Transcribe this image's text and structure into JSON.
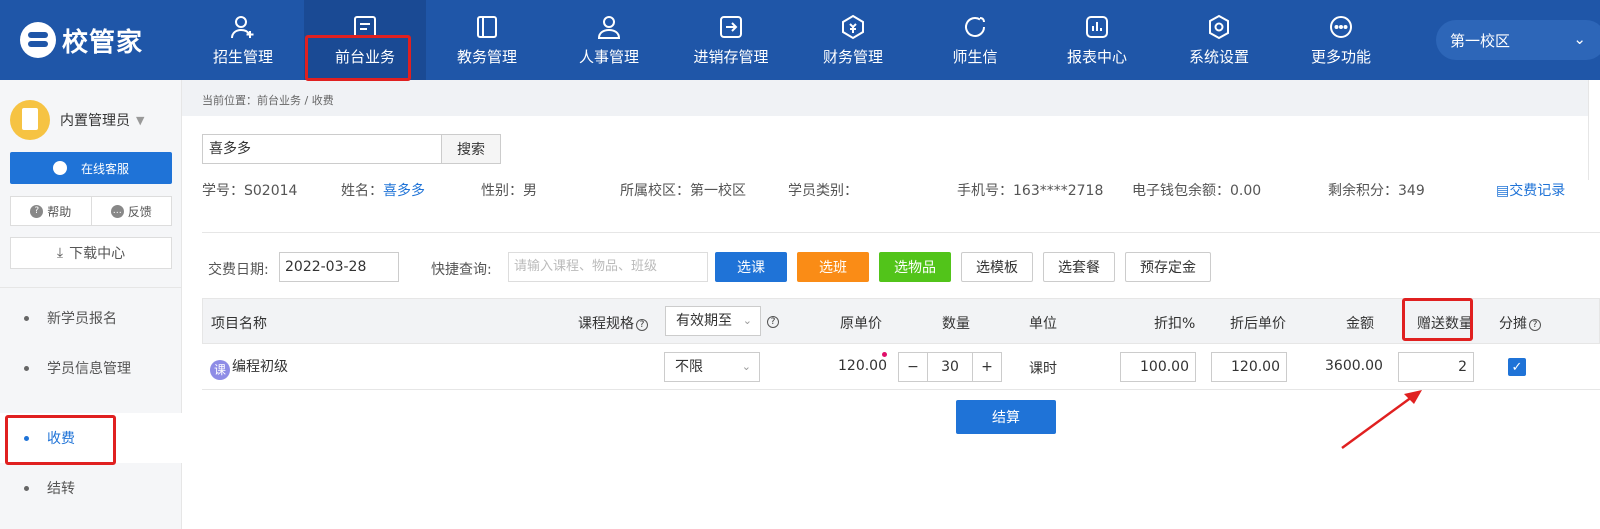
{
  "app": {
    "logo_text": "校管家"
  },
  "nav": {
    "items": [
      {
        "label": "招生管理",
        "icon": "user-plus-icon"
      },
      {
        "label": "前台业务",
        "icon": "front-desk-icon"
      },
      {
        "label": "教务管理",
        "icon": "book-icon"
      },
      {
        "label": "人事管理",
        "icon": "person-icon"
      },
      {
        "label": "进销存管理",
        "icon": "inventory-icon"
      },
      {
        "label": "财务管理",
        "icon": "finance-icon"
      },
      {
        "label": "师生信",
        "icon": "message-icon"
      },
      {
        "label": "报表中心",
        "icon": "report-icon"
      },
      {
        "label": "系统设置",
        "icon": "settings-icon"
      },
      {
        "label": "更多功能",
        "icon": "more-icon"
      }
    ],
    "campus": "第一校区"
  },
  "sidebar": {
    "user_name": "内置管理员",
    "service_btn": "在线客服",
    "help": "帮助",
    "feedback": "反馈",
    "download": "下载中心",
    "items": [
      {
        "label": "新学员报名"
      },
      {
        "label": "学员信息管理"
      },
      {
        "label": "收费"
      },
      {
        "label": "结转"
      }
    ]
  },
  "main": {
    "breadcrumb": "当前位置：前台业务 / 收费",
    "search_value": "喜多多",
    "search_btn": "搜索",
    "student": {
      "id_label": "学号：",
      "id_value": "S02014",
      "name_label": "姓名：",
      "name_value": "喜多多",
      "gender": "性别：男",
      "campus": "所属校区：第一校区",
      "category": "学员类别：",
      "phone": "手机号：163****2718",
      "wallet": "电子钱包余额：0.00",
      "points": "剩余积分：349",
      "record_link": "交费记录"
    },
    "pay_date_label": "交费日期:",
    "pay_date_value": "2022-03-28",
    "quick_label": "快捷查询:",
    "quick_placeholder": "请输入课程、物品、班级",
    "buttons": {
      "select_course": "选课",
      "select_class": "选班",
      "select_item": "选物品",
      "select_template": "选模板",
      "select_package": "选套餐",
      "deposit": "预存定金"
    },
    "table": {
      "headers": {
        "name": "项目名称",
        "spec": "课程规格",
        "validity": "有效期至",
        "orig_price": "原单价",
        "qty": "数量",
        "unit": "单位",
        "discount": "折扣%",
        "disc_price": "折后单价",
        "amount": "金额",
        "gift_qty": "赠送数量",
        "split": "分摊"
      },
      "rows": [
        {
          "badge": "课",
          "name": "编程初级",
          "validity": "不限",
          "orig_price": "120.00",
          "qty": "30",
          "unit": "课时",
          "discount": "100.00",
          "disc_price": "120.00",
          "amount": "3600.00",
          "gift_qty": "2",
          "split": true
        }
      ]
    },
    "settle_btn": "结算"
  },
  "colors": {
    "primary": "#1f73d7",
    "topbar": "#1f56a8",
    "highlight": "#e02020",
    "orange": "#fa8c16",
    "green": "#52c41a"
  }
}
